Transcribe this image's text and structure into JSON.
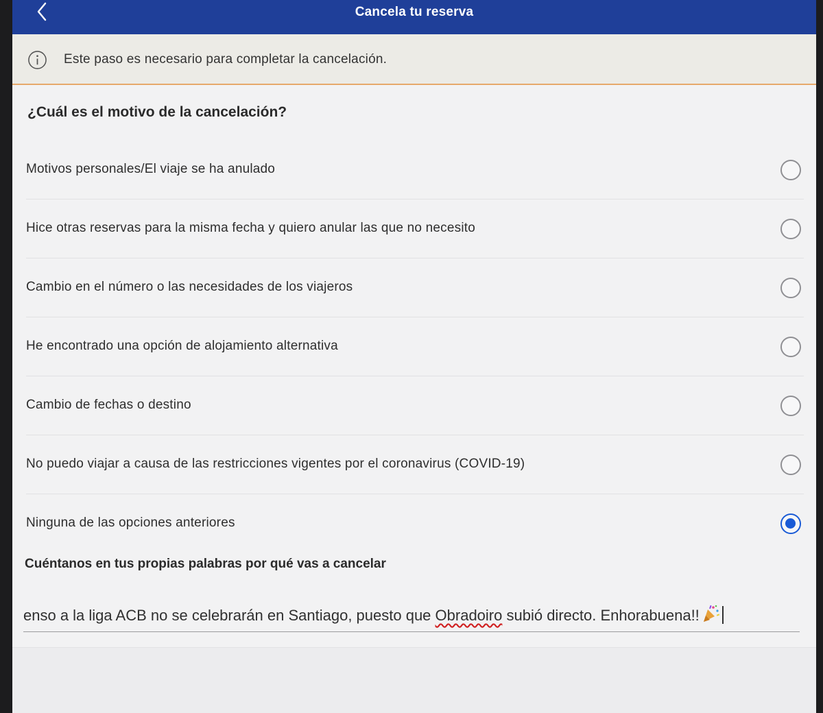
{
  "nav": {
    "title": "Cancela tu reserva"
  },
  "info": {
    "text": "Este paso es necesario para completar la cancelación."
  },
  "question": "¿Cuál es el motivo de la cancelación?",
  "options": [
    {
      "label": "Motivos personales/El viaje se ha anulado",
      "selected": false
    },
    {
      "label": "Hice otras reservas para la misma fecha y quiero anular las que no necesito",
      "selected": false
    },
    {
      "label": "Cambio en el número o las necesidades de los viajeros",
      "selected": false
    },
    {
      "label": "He encontrado una opción de alojamiento alternativa",
      "selected": false
    },
    {
      "label": "Cambio de fechas o destino",
      "selected": false
    },
    {
      "label": "No puedo viajar a causa de las restricciones vigentes por el coronavirus (COVID-19)",
      "selected": false
    },
    {
      "label": "Ninguna de las opciones anteriores",
      "selected": true
    }
  ],
  "explain": {
    "label": "Cuéntanos en tus propias palabras por qué vas a cancelar",
    "value_before": "enso a la liga ACB no se celebrarán en Santiago, puesto que ",
    "value_misspelled": "Obradoiro",
    "value_after": " subió directo. Enhorabuena!!"
  },
  "icons": {
    "back": "chevron-left-icon",
    "info": "info-icon",
    "emoji": "party-popper-icon"
  },
  "colors": {
    "navbar": "#1f3f99",
    "accent": "#1a5bd6",
    "banner_border": "#e6a86a"
  }
}
